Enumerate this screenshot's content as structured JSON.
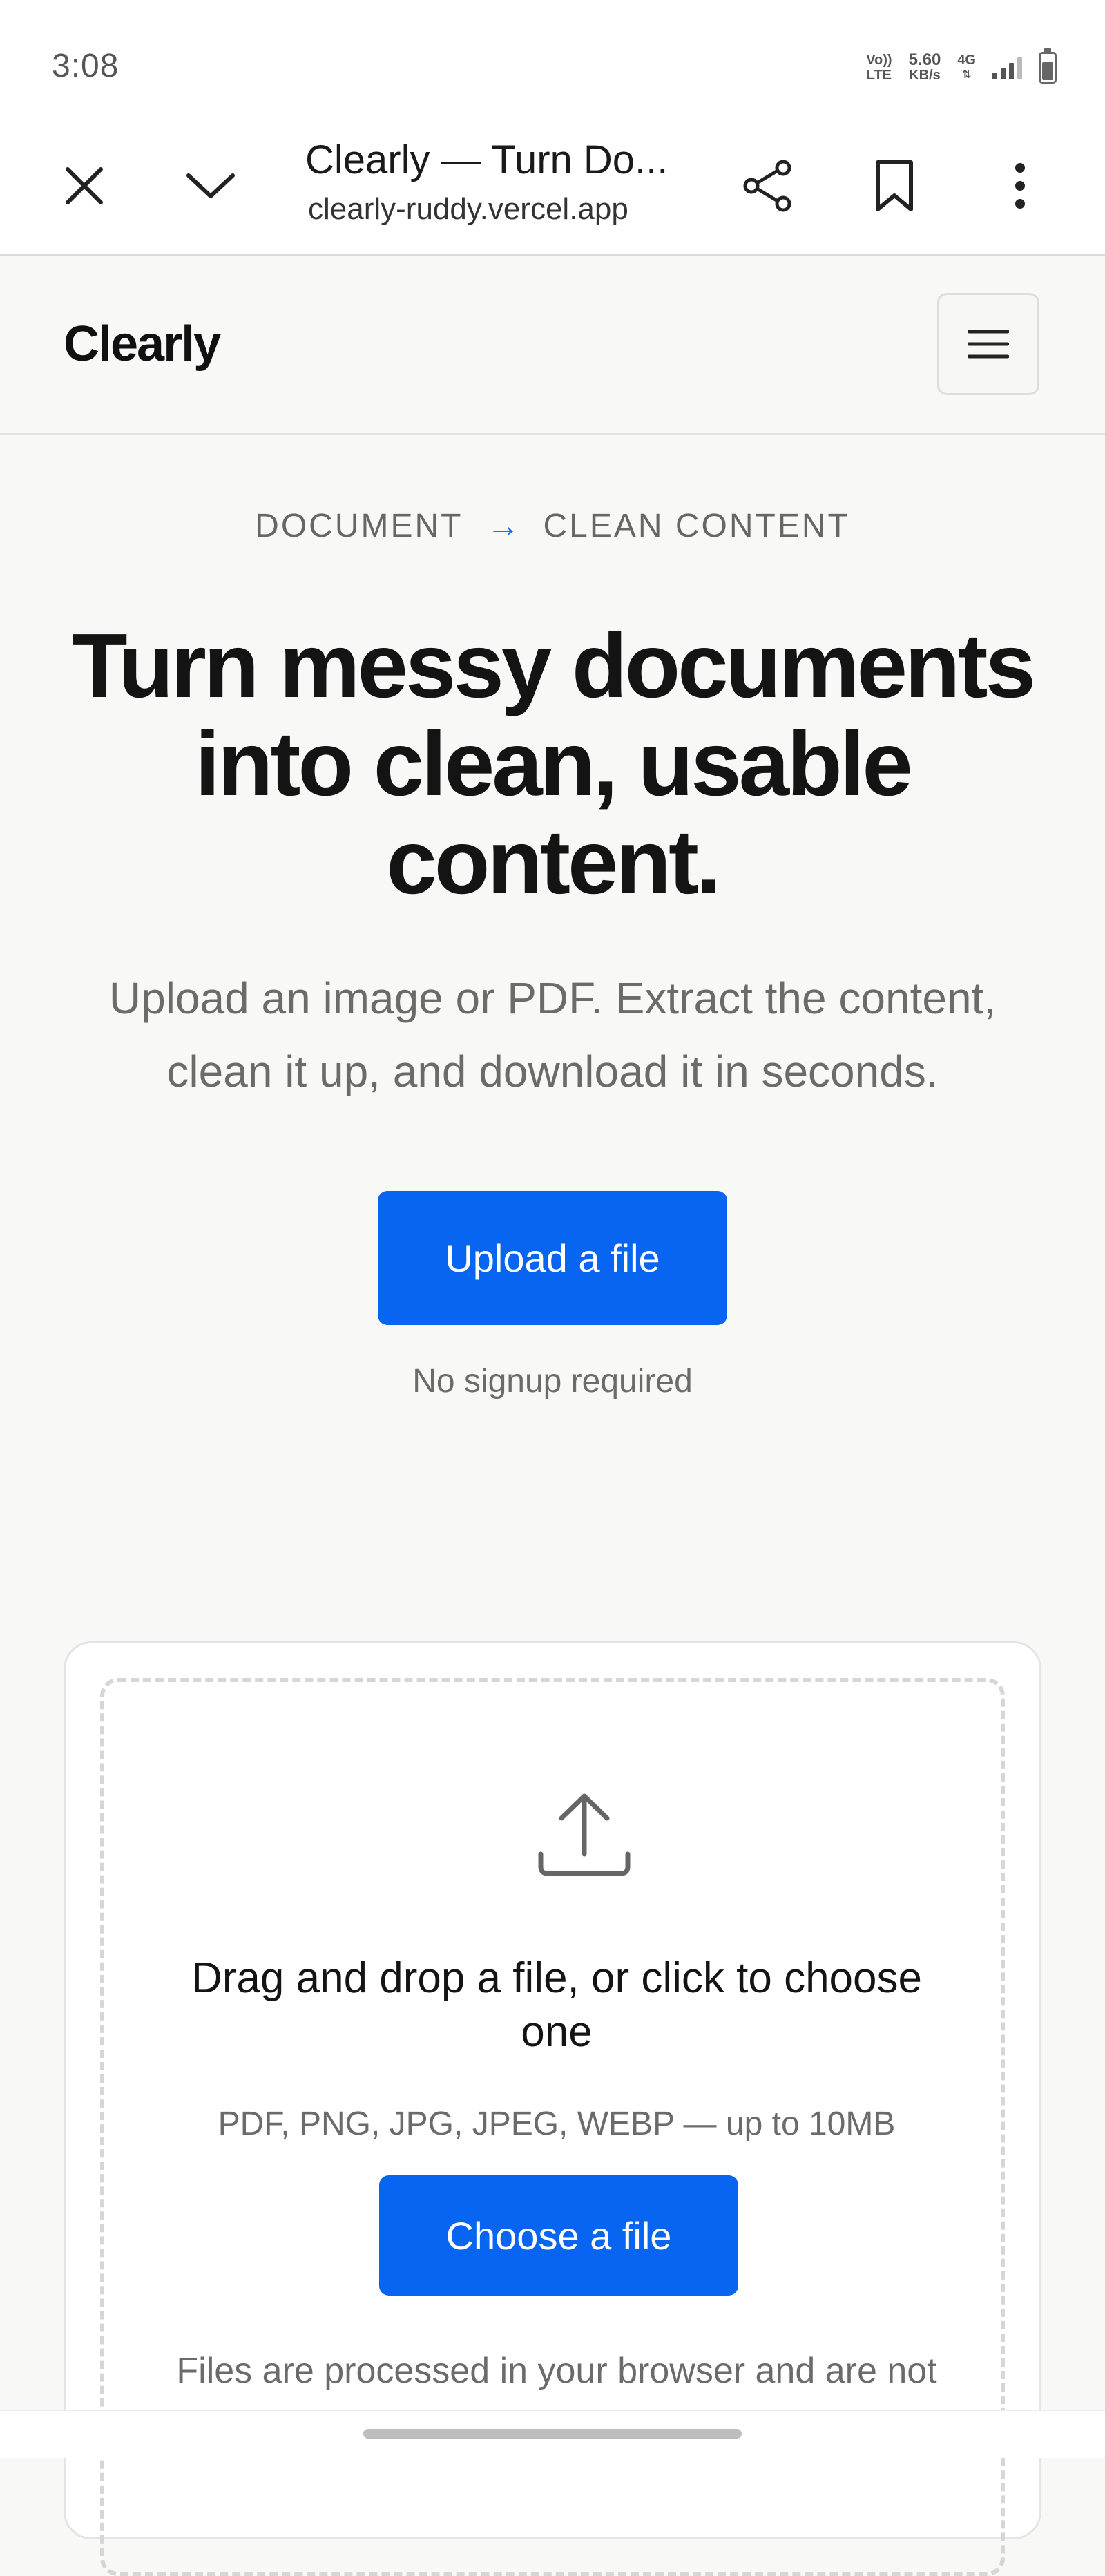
{
  "status_bar": {
    "time": "3:08",
    "volte_top": "Vo))",
    "volte_bottom": "LTE",
    "speed_value": "5.60",
    "speed_unit": "KB/s",
    "network": "4G"
  },
  "browser": {
    "tab_title": "Clearly — Turn Do...",
    "url": "clearly-ruddy.vercel.app",
    "icons": [
      "close-icon",
      "chevron-down-icon",
      "share-icon",
      "bookmark-icon",
      "more-vertical-icon"
    ]
  },
  "header": {
    "logo": "Clearly",
    "menu_icon": "hamburger-icon"
  },
  "hero": {
    "eyebrow_left": "DOCUMENT",
    "eyebrow_arrow": "→",
    "eyebrow_right": "CLEAN CONTENT",
    "title": "Turn messy documents into clean, usable content.",
    "subtitle": "Upload an image or PDF. Extract the content, clean it up, and download it in seconds.",
    "cta_label": "Upload a file",
    "cta_note": "No signup required"
  },
  "uploader": {
    "icon": "upload-icon",
    "title": "Drag and drop a file, or click to choose one",
    "formats": "PDF, PNG, JPG, JPEG, WEBP — up to 10MB",
    "button_label": "Choose a file",
    "note": "Files are processed in your browser and are not uploaded anywhere."
  },
  "colors": {
    "accent": "#0865f2",
    "background": "#f8f8f7",
    "text": "#141414",
    "muted": "#6b6b6b"
  }
}
